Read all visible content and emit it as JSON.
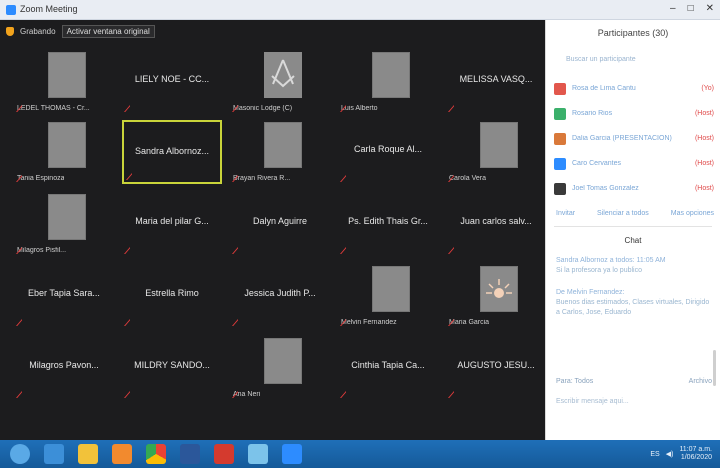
{
  "window": {
    "title": "Zoom Meeting"
  },
  "meeting_bar": {
    "status": "Grabando",
    "view_label": "Activar ventana original"
  },
  "tiles": [
    {
      "name": "LEDEL THOMAS - Cr...",
      "mode": "photo",
      "photo": "field"
    },
    {
      "name": "LIELY NOE - CC...",
      "mode": "text"
    },
    {
      "name": "Masonic Lodge (C)",
      "mode": "photo",
      "photo": "logo"
    },
    {
      "name": "Luis Alberto",
      "mode": "photo",
      "photo": "warm"
    },
    {
      "name": "MELISSA VASQ...",
      "mode": "text"
    },
    {
      "name": "Tania Espinoza",
      "mode": "photo",
      "photo": "glasses"
    },
    {
      "name": "Sandra Albornoz...",
      "mode": "text",
      "active": true
    },
    {
      "name": "Brayan Rivera R...",
      "mode": "photo",
      "photo": "couple"
    },
    {
      "name": "Carla Roque Al...",
      "mode": "text"
    },
    {
      "name": "Carola Vera",
      "mode": "photo",
      "photo": "light"
    },
    {
      "name": "Milagros Pisfil...",
      "mode": "photo",
      "photo": "red"
    },
    {
      "name": "Maria del pilar G...",
      "mode": "text"
    },
    {
      "name": "Dalyn Aguirre",
      "mode": "text"
    },
    {
      "name": "Ps. Edith Thais Gr...",
      "mode": "text"
    },
    {
      "name": "Juan carlos salv...",
      "mode": "text"
    },
    {
      "name": "Eber Tapia Sara...",
      "mode": "text"
    },
    {
      "name": "Estrella Rimo",
      "mode": "text"
    },
    {
      "name": "Jessica Judith P...",
      "mode": "text"
    },
    {
      "name": "Melvin Fernandez",
      "mode": "photo",
      "photo": "blue"
    },
    {
      "name": "Maria Garcia",
      "mode": "photo",
      "photo": "sun"
    },
    {
      "name": "Milagros Pavon...",
      "mode": "text"
    },
    {
      "name": "MILDRY SANDO...",
      "mode": "text"
    },
    {
      "name": "Ana Neri",
      "mode": "photo",
      "photo": "red"
    },
    {
      "name": "Cinthia Tapia Ca...",
      "mode": "text"
    },
    {
      "name": "AUGUSTO JESU...",
      "mode": "text"
    }
  ],
  "participants_panel": {
    "title": "Participantes (30)",
    "search_placeholder": "Buscar un participante",
    "items": [
      {
        "name": "Rosa de Lima Cantu",
        "status": "(Yo)",
        "color": "#e2574c"
      },
      {
        "name": "Rosario Rios",
        "status": "(Host)",
        "color": "#3bb06b"
      },
      {
        "name": "Dalia Garcia (PRESENTACION)",
        "status": "(Host)",
        "color": "#d9793a"
      },
      {
        "name": "Caro Cervantes",
        "status": "(Host)",
        "color": "#2d8cff"
      },
      {
        "name": "Joel Tomas Gonzalez",
        "status": "(Host)",
        "color": "#3a3a3a"
      }
    ],
    "actions": [
      "Invitar",
      "Silenciar a todos",
      "Mas opciones"
    ]
  },
  "chat": {
    "title": "Chat",
    "messages": [
      {
        "from": "Sandra Albornoz a todos: 11:05 AM",
        "text": "Si la profesora ya lo publico"
      },
      {
        "from": "De Melvin Fernandez:",
        "text": "Buenos dias estimados, Clases virtuales, Dirigido a Carlos, Jose, Eduardo"
      }
    ],
    "to_label": "Para: Todos",
    "file_label": "Archivo",
    "input_placeholder": "Escribir mensaje aqui..."
  },
  "taskbar": {
    "apps": [
      {
        "name": "windows-start-icon",
        "color": "#5aa9e6"
      },
      {
        "name": "internet-explorer-icon",
        "color": "#3c8fd8"
      },
      {
        "name": "file-explorer-icon",
        "color": "#f2c23a"
      },
      {
        "name": "media-player-icon",
        "color": "#f28a2e"
      },
      {
        "name": "chrome-icon",
        "color": "#e9e9e9"
      },
      {
        "name": "word-icon",
        "color": "#2b579a"
      },
      {
        "name": "acrobat-icon",
        "color": "#d43a2e"
      },
      {
        "name": "paint-icon",
        "color": "#7cc3ea"
      },
      {
        "name": "zoom-icon",
        "color": "#2d8cff"
      }
    ],
    "tray": {
      "lang": "ES",
      "time": "11:07 a.m.",
      "date": "1/06/2020"
    }
  },
  "colors": {
    "meeting_bg": "#1c1c1e",
    "active_border": "#c9d43a",
    "accent": "#2d8cff"
  }
}
